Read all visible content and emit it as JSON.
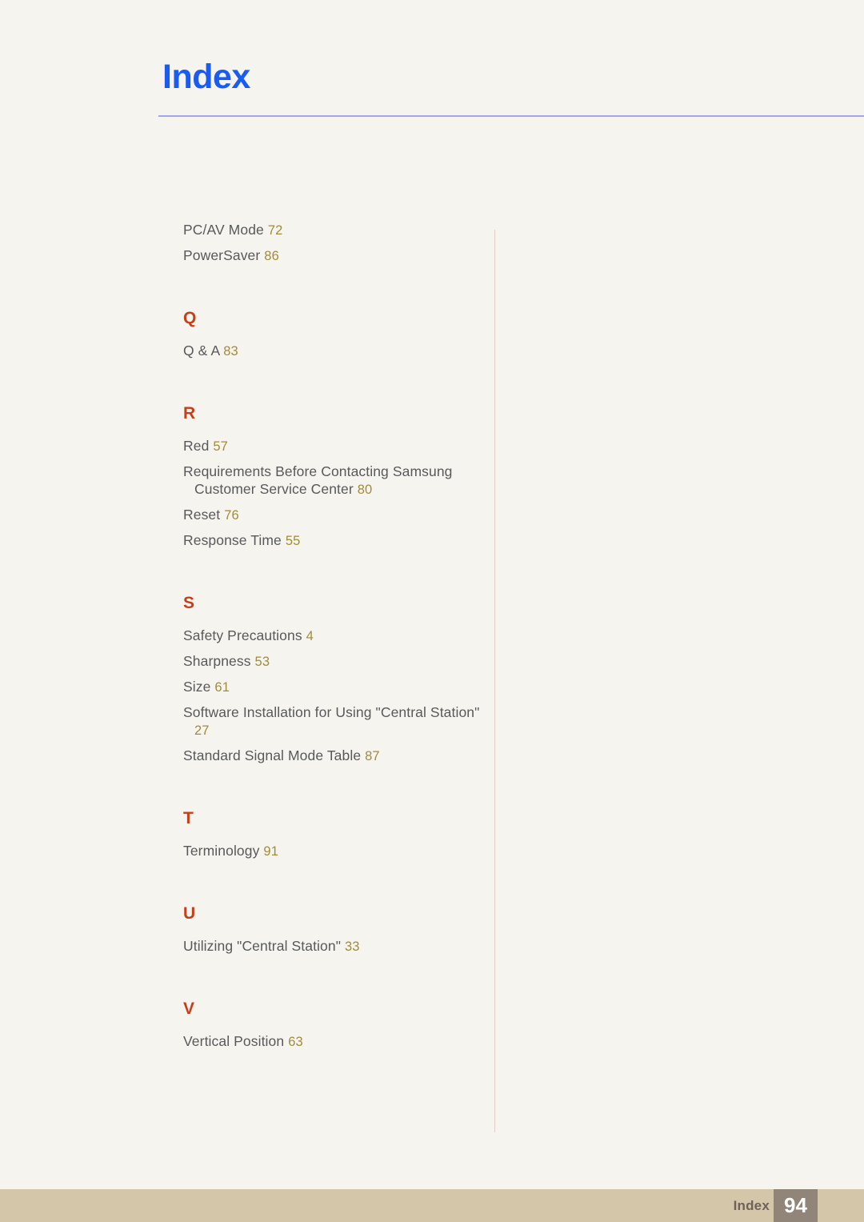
{
  "header": {
    "title": "Index"
  },
  "index": {
    "sections": [
      {
        "letter": "",
        "entries": [
          {
            "title": "PC/AV Mode",
            "page": "72",
            "wrapped": false
          },
          {
            "title": "PowerSaver",
            "page": "86",
            "wrapped": false
          }
        ]
      },
      {
        "letter": "Q",
        "entries": [
          {
            "title": "Q & A",
            "page": "83",
            "wrapped": false
          }
        ]
      },
      {
        "letter": "R",
        "entries": [
          {
            "title": "Red",
            "page": "57",
            "wrapped": false
          },
          {
            "title": "Requirements Before Contacting Samsung Customer Service Center",
            "page": "80",
            "wrapped": true
          },
          {
            "title": "Reset",
            "page": "76",
            "wrapped": false
          },
          {
            "title": "Response Time",
            "page": "55",
            "wrapped": false
          }
        ]
      },
      {
        "letter": "S",
        "entries": [
          {
            "title": "Safety Precautions",
            "page": "4",
            "wrapped": false
          },
          {
            "title": "Sharpness",
            "page": "53",
            "wrapped": false
          },
          {
            "title": "Size",
            "page": "61",
            "wrapped": false
          },
          {
            "title": "Software Installation for Using \"Central Station\"",
            "page": "27",
            "wrapped": true
          },
          {
            "title": "Standard Signal Mode Table",
            "page": "87",
            "wrapped": false
          }
        ]
      },
      {
        "letter": "T",
        "entries": [
          {
            "title": "Terminology",
            "page": "91",
            "wrapped": false
          }
        ]
      },
      {
        "letter": "U",
        "entries": [
          {
            "title": "Utilizing \"Central Station\"",
            "page": "33",
            "wrapped": false
          }
        ]
      },
      {
        "letter": "V",
        "entries": [
          {
            "title": "Vertical Position",
            "page": "63",
            "wrapped": false
          }
        ]
      }
    ]
  },
  "footer": {
    "label": "Index",
    "page_number": "94"
  },
  "colors": {
    "background": "#f6f4ee",
    "title": "#1a5cf0",
    "header_rule": "#a3a4f2",
    "section_letter": "#c5401a",
    "entry_text": "#58595b",
    "entry_page": "#a08c3c",
    "divider": "#e2cfc4",
    "footer_bar": "#d4c6a8",
    "footer_page_box": "#908578",
    "footer_label": "#6e625a"
  }
}
